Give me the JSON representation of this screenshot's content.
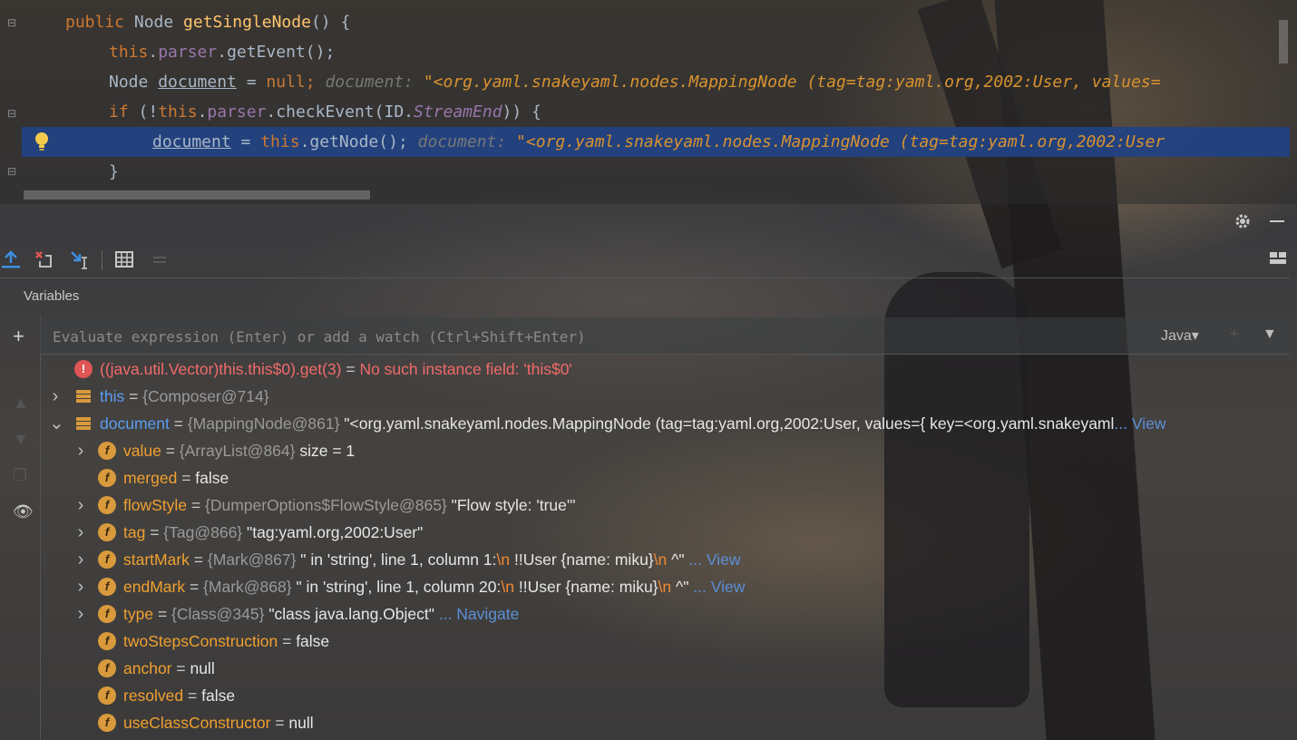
{
  "code": {
    "lines": [
      {
        "parts": [
          [
            "kw",
            "public "
          ],
          [
            "plain",
            "Node "
          ],
          [
            "fn",
            "getSingleNode"
          ],
          [
            "plain",
            "() {"
          ]
        ]
      },
      {
        "parts": [
          [
            "kw",
            "this"
          ],
          [
            "plain",
            "."
          ],
          [
            "fld",
            "parser"
          ],
          [
            "plain",
            ".getEvent();"
          ]
        ]
      },
      {
        "parts": [
          [
            "plain",
            "Node "
          ],
          [
            "under",
            "document"
          ],
          [
            "plain",
            " = "
          ],
          [
            "kw",
            "null"
          ],
          [
            "kw",
            ";"
          ]
        ],
        "inline_label": "document: ",
        "inline_value": "\"<org.yaml.snakeyaml.nodes.MappingNode (tag=tag:yaml.org,2002:User, values="
      },
      {
        "parts": [
          [
            "kw",
            "if "
          ],
          [
            "plain",
            "(!"
          ],
          [
            "kw",
            "this"
          ],
          [
            "plain",
            "."
          ],
          [
            "fld",
            "parser"
          ],
          [
            "plain",
            ".checkEvent(ID."
          ],
          [
            "fldi",
            "StreamEnd"
          ],
          [
            "plain",
            ")) {"
          ]
        ]
      },
      {
        "parts": [
          [
            "under",
            "document"
          ],
          [
            "plain",
            " = "
          ],
          [
            "kw",
            "this"
          ],
          [
            "plain",
            ".getNode();"
          ]
        ],
        "inline_label": "document: ",
        "inline_value": "\"<org.yaml.snakeyaml.nodes.MappingNode (tag=tag:yaml.org,2002:User"
      },
      {
        "parts": [
          [
            "plain",
            "}"
          ]
        ]
      }
    ]
  },
  "panel": {
    "title": "Variables",
    "eval_placeholder": "Evaluate expression (Enter) or add a watch (Ctrl+Shift+Enter)",
    "language": "Java"
  },
  "rows": [
    {
      "kind": "error",
      "expr": "((java.util.Vector)this.this$0).get(3)",
      "eq": " = ",
      "msg": "No such instance field: 'this$0'"
    },
    {
      "kind": "obj",
      "expand": "right",
      "name": "this",
      "eq": " = ",
      "ref": "{Composer@714}"
    },
    {
      "kind": "obj",
      "expand": "down",
      "name": "document",
      "eq": " = ",
      "ref": "{MappingNode@861}",
      "val": " \"<org.yaml.snakeyaml.nodes.MappingNode (tag=tag:yaml.org,2002:User, values={ key=<org.yaml.snakeyaml",
      "link": "... View"
    },
    {
      "kind": "field",
      "expand": "right",
      "name": "value",
      "eq": " = ",
      "ref": "{ArrayList@864}",
      "val": "  size = 1"
    },
    {
      "kind": "field",
      "name": "merged",
      "eq": " = ",
      "val": "false"
    },
    {
      "kind": "field",
      "expand": "right",
      "name": "flowStyle",
      "eq": " = ",
      "ref": "{DumperOptions$FlowStyle@865}",
      "val": " \"Flow style: 'true'\""
    },
    {
      "kind": "field",
      "expand": "right",
      "name": "tag",
      "eq": " = ",
      "ref": "{Tag@866}",
      "val": " \"tag:yaml.org,2002:User\""
    },
    {
      "kind": "field",
      "expand": "right",
      "name": "startMark",
      "eq": " = ",
      "ref": "{Mark@867}",
      "segs": [
        " \" in 'string', line 1, column 1:",
        "\\n",
        "    !!User {name: miku}",
        "\\n",
        "    ^\" "
      ],
      "link": "... View"
    },
    {
      "kind": "field",
      "expand": "right",
      "name": "endMark",
      "eq": " = ",
      "ref": "{Mark@868}",
      "segs": [
        " \" in 'string', line 1, column 20:",
        "\\n",
        "    !!User {name: miku}",
        "\\n",
        "                        ^\" "
      ],
      "link": "... View"
    },
    {
      "kind": "field",
      "expand": "right",
      "name": "type",
      "eq": " = ",
      "ref": "{Class@345}",
      "val": " \"class java.lang.Object\" ",
      "link": "... Navigate"
    },
    {
      "kind": "field",
      "name": "twoStepsConstruction",
      "eq": " = ",
      "val": "false"
    },
    {
      "kind": "field",
      "name": "anchor",
      "eq": " = ",
      "val": "null"
    },
    {
      "kind": "field",
      "name": "resolved",
      "eq": " = ",
      "val": "false"
    },
    {
      "kind": "field",
      "name": "useClassConstructor",
      "eq": " = ",
      "val": "null"
    }
  ],
  "icons": {
    "field": "f",
    "settings": "gear-icon",
    "minimize": "minimize-icon"
  },
  "colors": {
    "keyword": "#cc7832",
    "method": "#ffc66d",
    "field": "#9876aa",
    "highlight": "#214283",
    "error": "#f06a6a",
    "link": "#5c8fd6"
  }
}
